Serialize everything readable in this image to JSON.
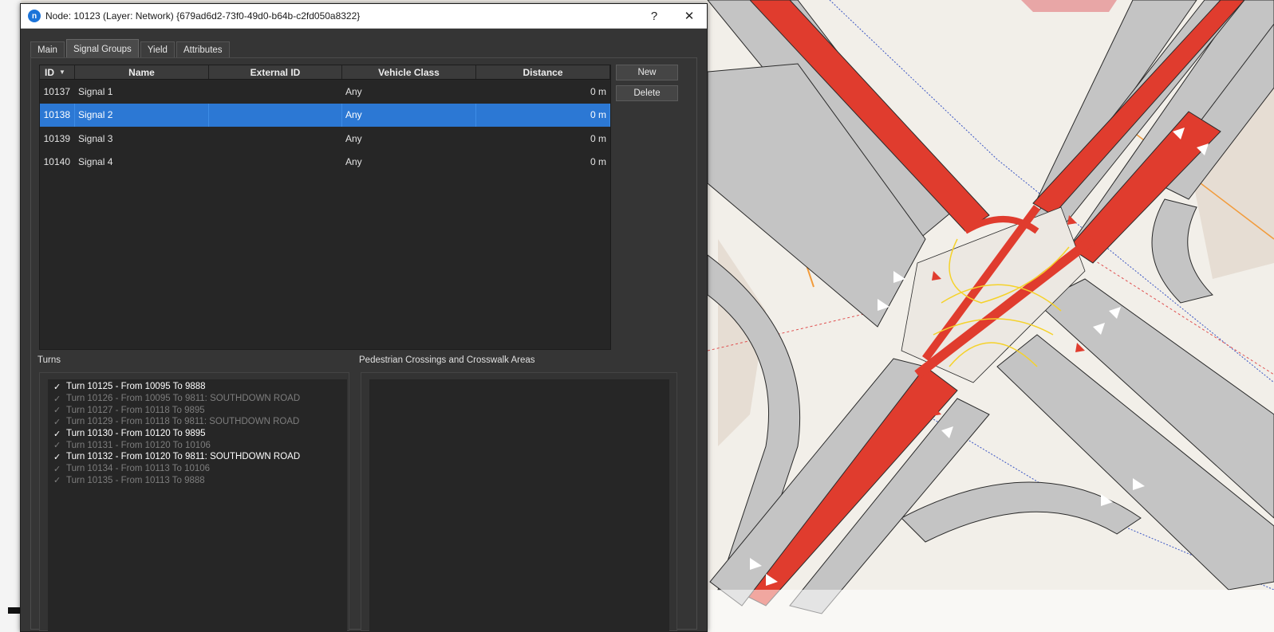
{
  "dialog": {
    "title": "Node: 10123 (Layer: Network) {679ad6d2-73f0-49d0-b64b-c2fd050a8322}",
    "app_icon": "n",
    "help_label": "?",
    "close_label": "✕"
  },
  "tabs": [
    {
      "label": "Main",
      "active": false
    },
    {
      "label": "Signal Groups",
      "active": true
    },
    {
      "label": "Yield",
      "active": false
    },
    {
      "label": "Attributes",
      "active": false
    }
  ],
  "signal_table": {
    "columns": [
      "ID",
      "Name",
      "External ID",
      "Vehicle Class",
      "Distance"
    ],
    "rows": [
      {
        "id": "10137",
        "name": "Signal 1",
        "external_id": "",
        "vehicle_class": "Any",
        "distance": "0 m",
        "selected": false
      },
      {
        "id": "10138",
        "name": "Signal 2",
        "external_id": "",
        "vehicle_class": "Any",
        "distance": "0 m",
        "selected": true
      },
      {
        "id": "10139",
        "name": "Signal 3",
        "external_id": "",
        "vehicle_class": "Any",
        "distance": "0 m",
        "selected": false
      },
      {
        "id": "10140",
        "name": "Signal 4",
        "external_id": "",
        "vehicle_class": "Any",
        "distance": "0 m",
        "selected": false
      }
    ],
    "sort_indicator": "▼"
  },
  "buttons": {
    "new_label": "New",
    "delete_label": "Delete"
  },
  "turns": {
    "label": "Turns",
    "check_glyph": "✓",
    "items": [
      {
        "text": "Turn 10125 - From 10095 To 9888",
        "enabled": true
      },
      {
        "text": "Turn 10126 - From 10095 To 9811: SOUTHDOWN ROAD",
        "enabled": false
      },
      {
        "text": "Turn 10127 - From 10118 To 9895",
        "enabled": false
      },
      {
        "text": "Turn 10129 - From 10118 To 9811: SOUTHDOWN ROAD",
        "enabled": false
      },
      {
        "text": "Turn 10130 - From 10120 To 9895",
        "enabled": true
      },
      {
        "text": "Turn 10131 - From 10120 To 10106",
        "enabled": false
      },
      {
        "text": "Turn 10132 - From 10120 To 9811: SOUTHDOWN ROAD",
        "enabled": true
      },
      {
        "text": "Turn 10134 - From 10113 To 10106",
        "enabled": false
      },
      {
        "text": "Turn 10135 - From 10113 To 9888",
        "enabled": false
      }
    ]
  },
  "pedestrian": {
    "label": "Pedestrian Crossings and Crosswalk Areas"
  },
  "colors": {
    "accent_selected": "#2c78d4",
    "bus_lane": "#e03c2e",
    "road": "#c4c4c4",
    "map_bg": "#f2efe9"
  }
}
